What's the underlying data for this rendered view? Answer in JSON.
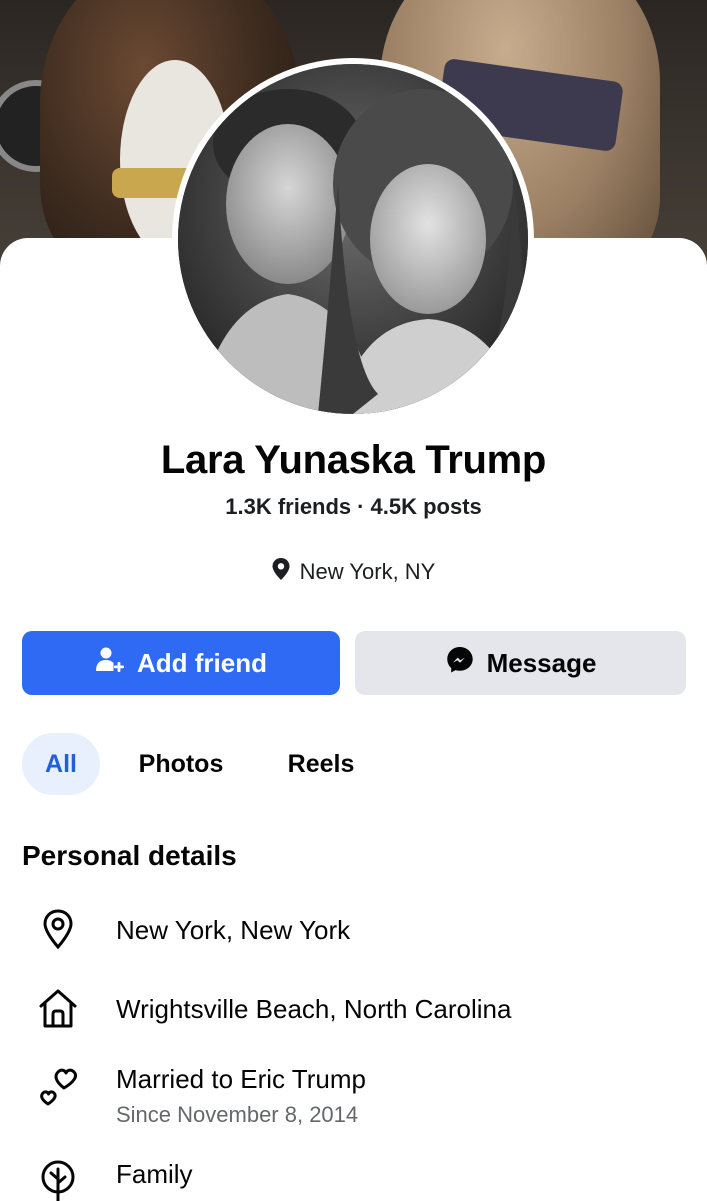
{
  "profile": {
    "name": "Lara Yunaska Trump",
    "friends": "1.3K friends",
    "separator": "·",
    "posts": "4.5K posts",
    "location": "New York, NY"
  },
  "actions": {
    "add_friend_label": "Add friend",
    "message_label": "Message"
  },
  "tabs": [
    {
      "label": "All",
      "selected": true
    },
    {
      "label": "Photos",
      "selected": false
    },
    {
      "label": "Reels",
      "selected": false
    }
  ],
  "personal_details": {
    "title": "Personal details",
    "items": [
      {
        "icon": "location-pin-icon",
        "text": "New York, New York"
      },
      {
        "icon": "home-icon",
        "text": "Wrightsville Beach, North Carolina"
      },
      {
        "icon": "hearts-icon",
        "text": "Married to Eric Trump",
        "sub": "Since November 8, 2014"
      },
      {
        "icon": "family-tree-icon",
        "text": "Family"
      }
    ]
  },
  "colors": {
    "primary_button": "#2f6af5",
    "secondary_button": "#e4e6eb",
    "tab_selected_bg": "#e7f0fc",
    "tab_selected_text": "#2160d8",
    "secondary_text": "#65676b"
  }
}
